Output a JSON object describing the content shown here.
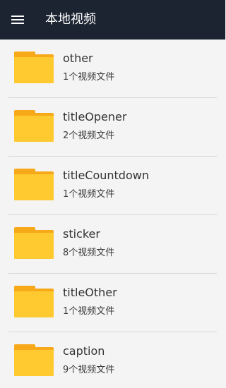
{
  "app_bar": {
    "title": "本地视频",
    "menu_icon": "menu-icon",
    "background": "#1c2431"
  },
  "folders": [
    {
      "name": "other",
      "count": "1个视频文件",
      "icon": "folder-icon"
    },
    {
      "name": "titleOpener",
      "count": "2个视频文件",
      "icon": "folder-icon"
    },
    {
      "name": "titleCountdown",
      "count": "1个视频文件",
      "icon": "folder-icon"
    },
    {
      "name": "sticker",
      "count": "8个视频文件",
      "icon": "folder-icon"
    },
    {
      "name": "titleOther",
      "count": "1个视频文件",
      "icon": "folder-icon"
    },
    {
      "name": "caption",
      "count": "9个视频文件",
      "icon": "folder-icon"
    }
  ],
  "colors": {
    "folder_front": "#ffc930",
    "folder_back": "#f7a919",
    "background": "#f4f4f4"
  }
}
